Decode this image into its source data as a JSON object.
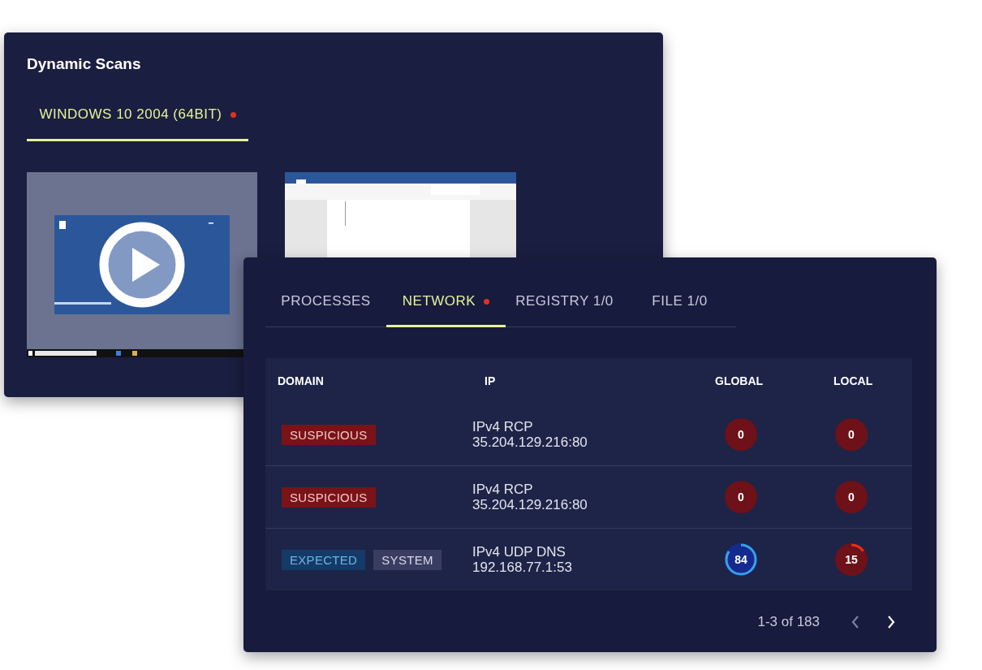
{
  "scans_card": {
    "title": "Dynamic Scans",
    "tabs": [
      {
        "label": "WINDOWS 10 2004 (64BIT)",
        "selected": true,
        "alert": true
      }
    ],
    "thumbnails": [
      {
        "kind": "picture",
        "playable": true
      },
      {
        "kind": "picture",
        "playable": false
      }
    ]
  },
  "details_card": {
    "tabs": [
      {
        "label": "PROCESSES",
        "selected": false,
        "alert": false
      },
      {
        "label": "NETWORK",
        "selected": true,
        "alert": true
      },
      {
        "label": "REGISTRY 1/0",
        "selected": false,
        "alert": false
      },
      {
        "label": "FILE 1/0",
        "selected": false,
        "alert": false
      }
    ],
    "table": {
      "columns": [
        "DOMAIN",
        "IP",
        "GLOBAL",
        "LOCAL"
      ],
      "rows": [
        {
          "tags": [
            {
              "label": "SUSPICIOUS",
              "kind": "suspicious"
            }
          ],
          "protocol": "IPv4 RCP",
          "address": "35.204.129.216:80",
          "global": {
            "value": "0",
            "kind": "danger"
          },
          "local": {
            "value": "0",
            "kind": "danger"
          }
        },
        {
          "tags": [
            {
              "label": "SUSPICIOUS",
              "kind": "suspicious"
            }
          ],
          "protocol": "IPv4 RCP",
          "address": "35.204.129.216:80",
          "global": {
            "value": "0",
            "kind": "danger"
          },
          "local": {
            "value": "0",
            "kind": "danger"
          }
        },
        {
          "tags": [
            {
              "label": "EXPECTED",
              "kind": "expected"
            },
            {
              "label": "SYSTEM",
              "kind": "system"
            }
          ],
          "protocol": "IPv4 UDP DNS",
          "address": "192.168.77.1:53",
          "global": {
            "value": "84",
            "kind": "info",
            "level": 0.84
          },
          "local": {
            "value": "15",
            "kind": "danger",
            "level": 0.15
          }
        }
      ]
    },
    "pager": {
      "range": "1-3 of 183",
      "prev_disabled": true,
      "next_disabled": false
    }
  }
}
